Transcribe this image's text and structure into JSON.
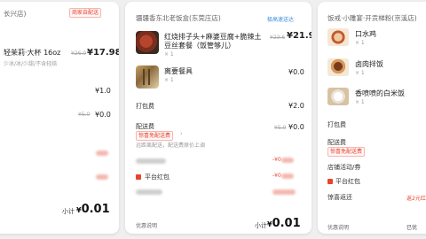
{
  "left": {
    "shop_suffix": "长兴店)",
    "badge": "商家自配送",
    "product_name": "轻茉莉·大杯 16oz",
    "product_spec": "少冰/冰/少甜/不含轻焙",
    "price_original": "¥26.0",
    "price": "¥17.98",
    "row1_price": "¥1.0",
    "row2_strike": "¥5.0",
    "row2_price": "¥0.0",
    "subtotal_label": "小计",
    "subtotal_yen": "¥",
    "subtotal": "0.01"
  },
  "mid": {
    "shop": "疆疆香东北老饭盒(东莞庄店)",
    "shop_tag": "极高速送达",
    "item1_name_line1": "红烧排子头+麻婆豆腐+脆辣土",
    "item1_name_line2": "豆丝套餐（饭管够儿）",
    "item1_qty": "× 1",
    "item1_strike": "¥23.6",
    "item1_price": "¥21.9",
    "item2_name": "离要餐具",
    "item2_qty": "× 1",
    "item2_price": "¥0.0",
    "pack_label": "打包费",
    "pack_price": "¥2.0",
    "delivery_label": "配送费",
    "delivery_strike": "¥5.0",
    "delivery_price": "¥0.0",
    "delivery_badge": "惊喜免配送费",
    "delivery_note": "远距离配送，配送费原价上调",
    "blur_right1": "-¥0",
    "blur_right2": "-¥0",
    "platform_label": "平台红包",
    "coupon_label": "优惠说明",
    "subtotal_label": "小计",
    "subtotal_yen": "¥",
    "subtotal": "0.01"
  },
  "right": {
    "shop": "饭戒·小雕宴·开贡梯粉(京溪店)",
    "item1_name": "口水鸡",
    "item1_qty": "× 1",
    "item2_name": "卤肉拌饭",
    "item2_qty": "× 1",
    "item3_name": "香喷喷的白米饭",
    "item3_qty": "× 1",
    "pack_label": "打包费",
    "delivery_label": "配送费",
    "delivery_badge": "惊喜免配送费",
    "store_promo_label": "店铺活动/券",
    "platform_label": "平台红包",
    "gift_label": "惊喜返还",
    "gift_value": "返2元红包",
    "coupon_label": "优惠说明",
    "status": "已优"
  },
  "colors": {
    "accent_red": "#e8432e",
    "card_bg": "#ffffff",
    "page_bg": "#efefef",
    "gift_orange": "#d9993a"
  }
}
